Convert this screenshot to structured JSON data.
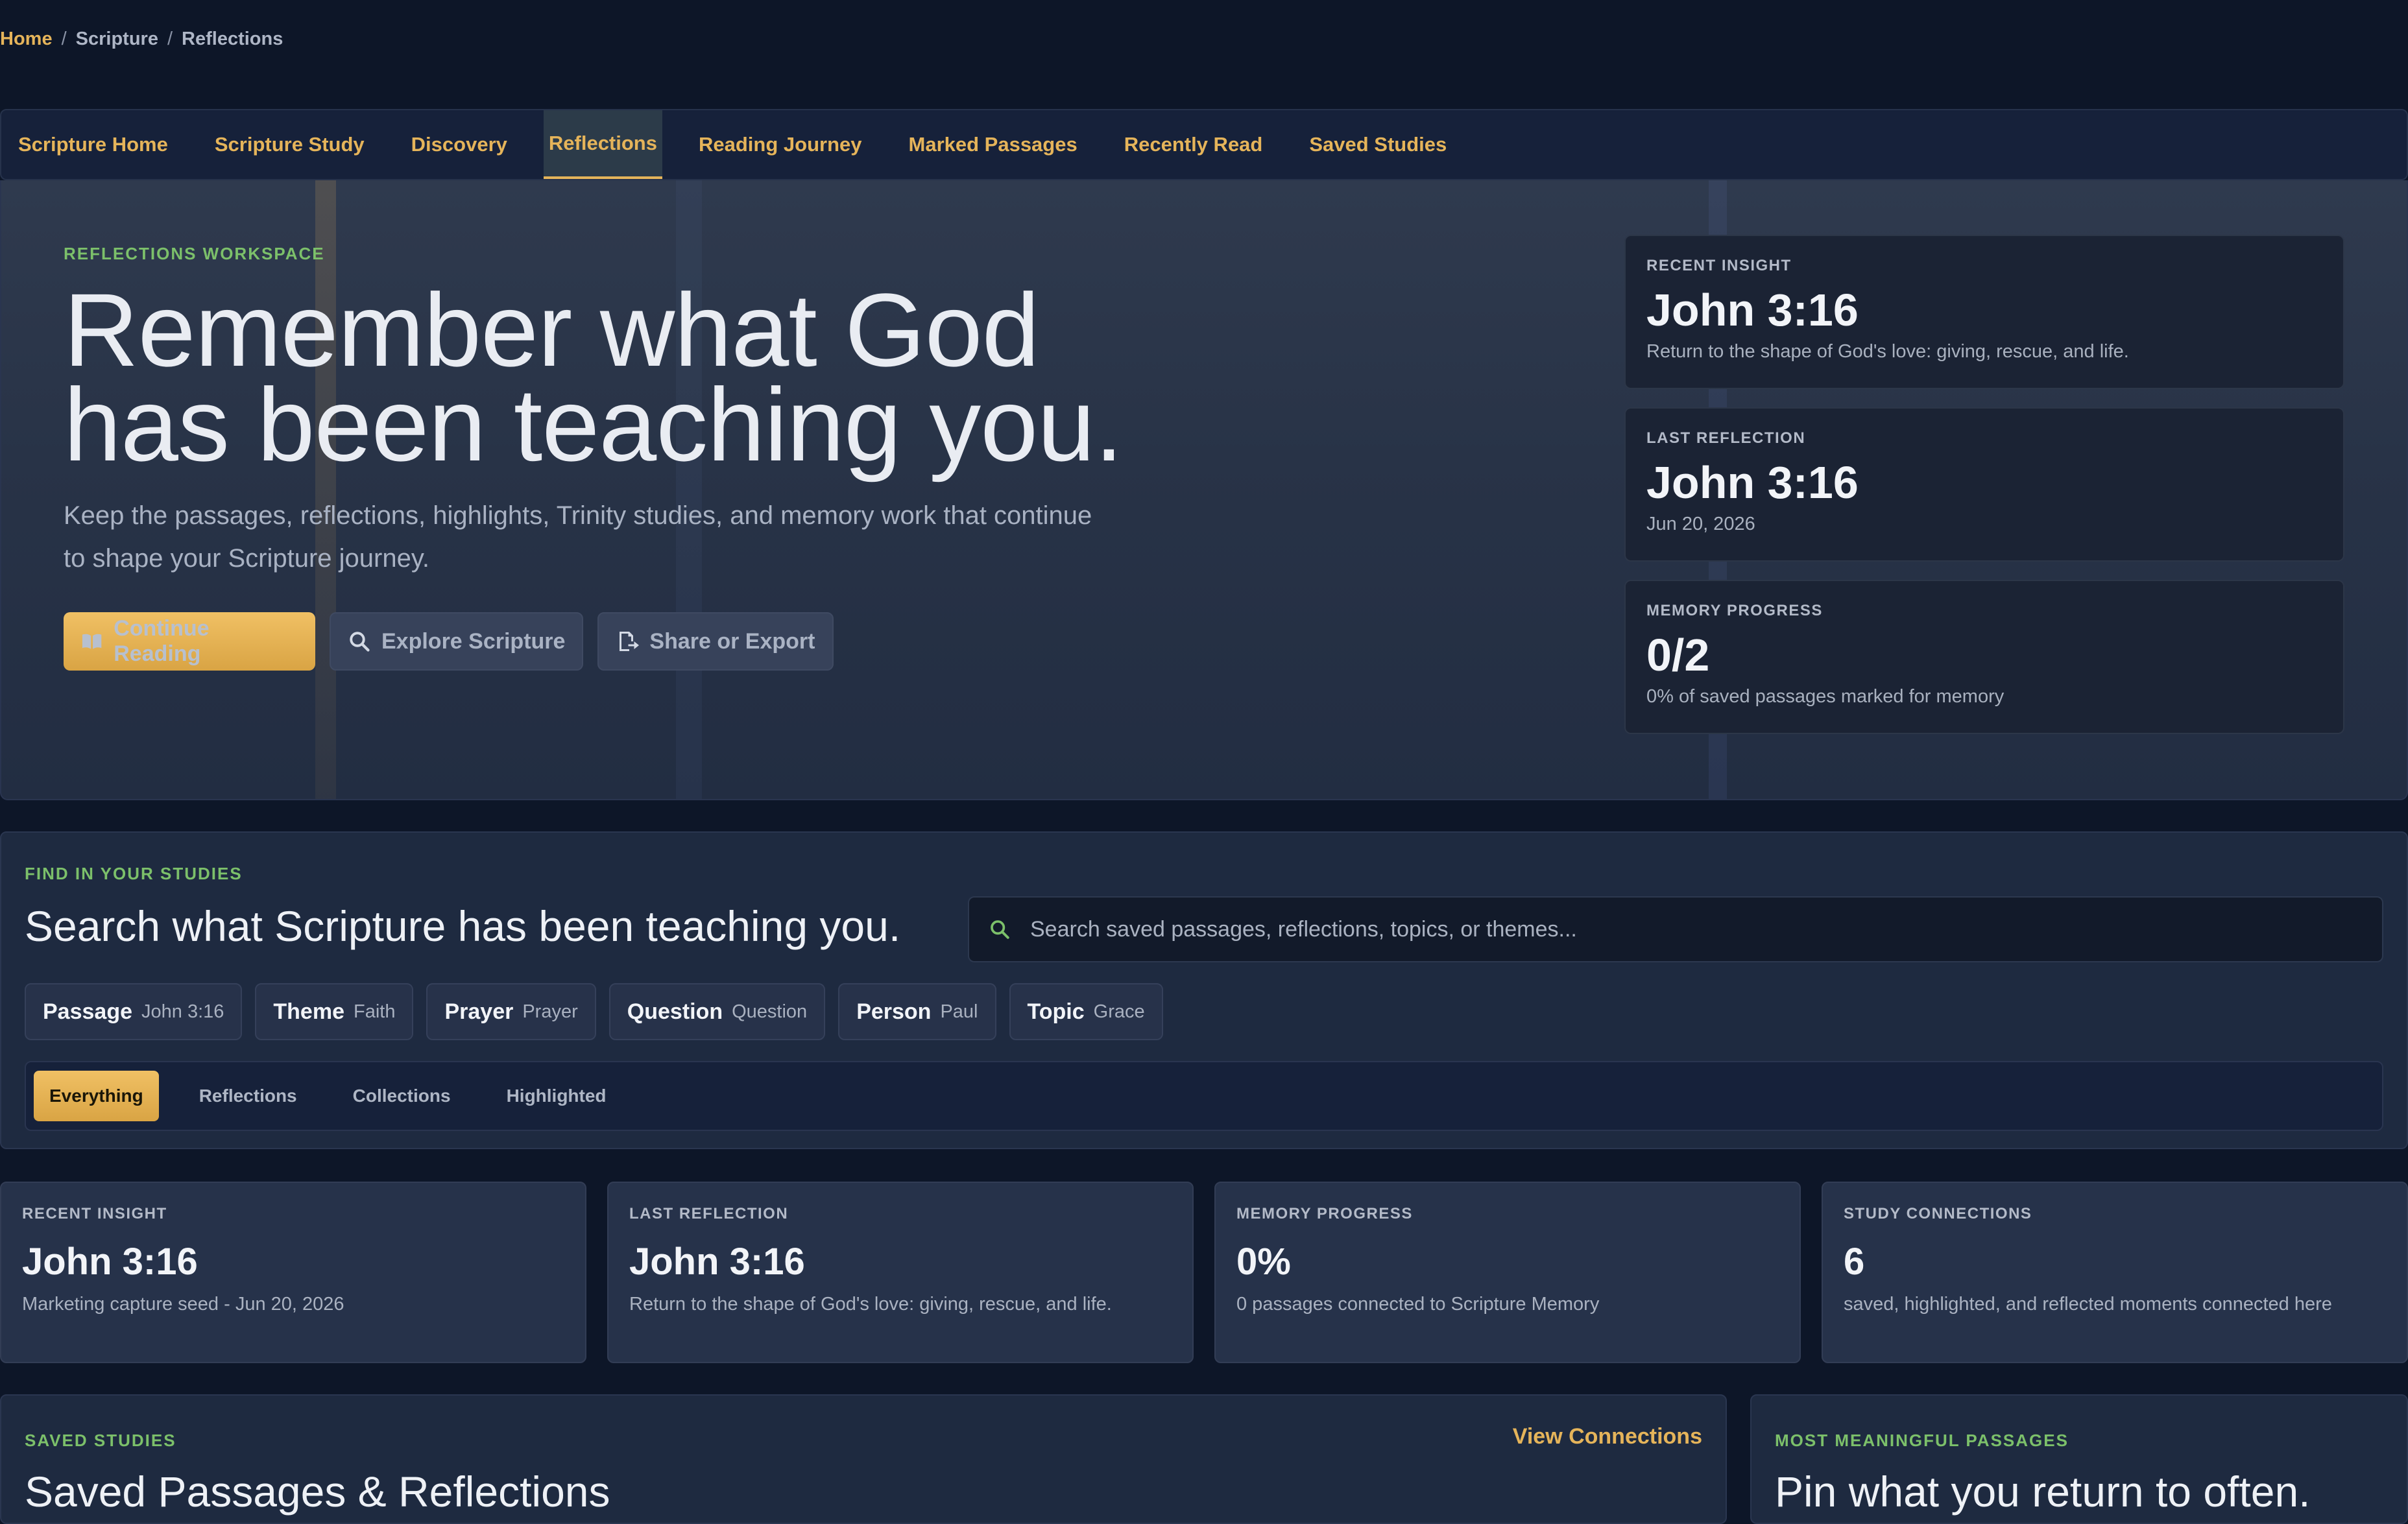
{
  "breadcrumb": {
    "home": "Home",
    "items": [
      "Scripture",
      "Reflections"
    ]
  },
  "nav": {
    "tabs": [
      "Scripture Home",
      "Scripture Study",
      "Discovery",
      "Reflections",
      "Reading Journey",
      "Marked Passages",
      "Recently Read",
      "Saved Studies"
    ],
    "active": "Reflections"
  },
  "hero": {
    "eyebrow": "REFLECTIONS WORKSPACE",
    "title_line1": "Remember what God",
    "title_line2": "has been teaching you.",
    "subtitle": "Keep the passages, reflections, highlights, Trinity studies, and memory work that continue to shape your Scripture journey.",
    "actions": {
      "continue": "Continue Reading",
      "explore": "Explore Scripture",
      "share": "Share or Export"
    },
    "cards": [
      {
        "label": "RECENT INSIGHT",
        "value": "John 3:16",
        "desc": "Return to the shape of God's love: giving, rescue, and life."
      },
      {
        "label": "LAST REFLECTION",
        "value": "John 3:16",
        "desc": "Jun 20, 2026"
      },
      {
        "label": "MEMORY PROGRESS",
        "value": "0/2",
        "desc": "0% of saved passages marked for memory"
      }
    ]
  },
  "search": {
    "eyebrow": "FIND IN YOUR STUDIES",
    "title": "Search what Scripture has been teaching you.",
    "placeholder": "Search saved passages, reflections, topics, or themes...",
    "chips": [
      {
        "key": "Passage",
        "value": "John 3:16"
      },
      {
        "key": "Theme",
        "value": "Faith"
      },
      {
        "key": "Prayer",
        "value": "Prayer"
      },
      {
        "key": "Question",
        "value": "Question"
      },
      {
        "key": "Person",
        "value": "Paul"
      },
      {
        "key": "Topic",
        "value": "Grace"
      }
    ],
    "filters": [
      "Everything",
      "Reflections",
      "Collections",
      "Highlighted"
    ],
    "active_filter": "Everything"
  },
  "stats": [
    {
      "label": "RECENT INSIGHT",
      "value": "John 3:16",
      "desc": "Marketing capture seed - Jun 20, 2026"
    },
    {
      "label": "LAST REFLECTION",
      "value": "John 3:16",
      "desc": "Return to the shape of God's love: giving, rescue, and life."
    },
    {
      "label": "MEMORY PROGRESS",
      "value": "0%",
      "desc": "0 passages connected to Scripture Memory"
    },
    {
      "label": "STUDY CONNECTIONS",
      "value": "6",
      "desc": "saved, highlighted, and reflected moments connected here"
    }
  ],
  "saved": {
    "eyebrow": "SAVED STUDIES",
    "title": "Saved Passages & Reflections",
    "link": "View Connections"
  },
  "meaningful": {
    "eyebrow": "MOST MEANINGFUL PASSAGES",
    "title": "Pin what you return to often."
  },
  "colors": {
    "accent": "#e5b45a",
    "green": "#7cc06a",
    "bg": "#0d1628"
  },
  "icons": {
    "continue": "book-icon",
    "explore": "search-icon",
    "share": "export-icon"
  }
}
